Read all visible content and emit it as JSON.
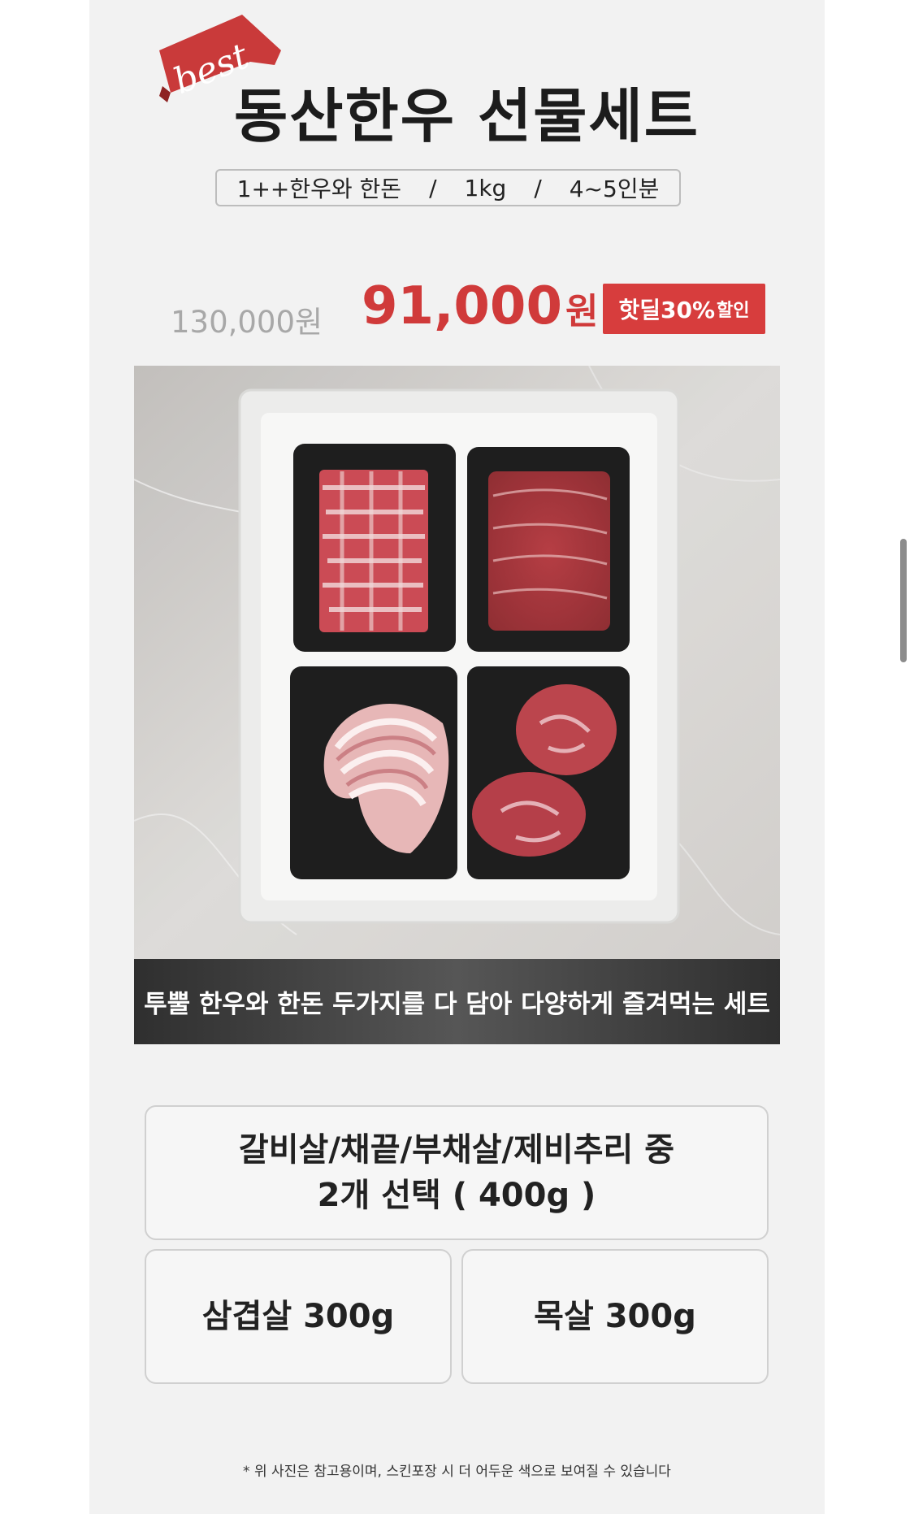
{
  "header": {
    "badge_text": "best",
    "title": "동산한우 선물세트",
    "spec": {
      "item1": "1++한우와 한돈",
      "sep": "/",
      "item2": "1kg",
      "item3": "4~5인분"
    }
  },
  "price": {
    "original": "130,000원",
    "sale_amount": "91,000",
    "sale_unit": "원",
    "badge_main": "핫딜30%",
    "badge_small": "할인"
  },
  "photo": {
    "caption": "투뿔 한우와 한돈 두가지를 다 담아 다양하게 즐겨먹는 세트"
  },
  "options": {
    "main_line1": "갈비살/채끝/부채살/제비추리 중",
    "main_line2": "2개 선택 ( 400g )",
    "left": "삼겹살 300g",
    "right": "목살 300g"
  },
  "note": "*  위 사진은 참고용이며, 스킨포장 시 더 어두운 색으로 보여질 수 있습니다",
  "colors": {
    "accent": "#d03a3a",
    "badge": "#d73d3d",
    "page_bg": "#f2f2f2",
    "caption_bar": "#3a3a3a"
  }
}
